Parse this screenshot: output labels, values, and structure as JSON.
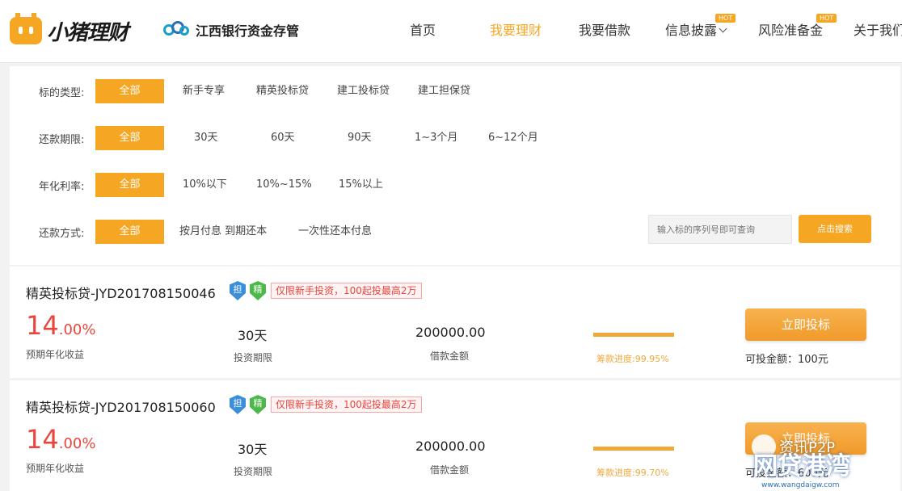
{
  "header": {
    "brand": "小猪理财",
    "bank": "江西银行资金存管",
    "nav": [
      {
        "label": "首页"
      },
      {
        "label": "我要理财"
      },
      {
        "label": "我要借款"
      },
      {
        "label": "信息披露",
        "badge": "HOT"
      },
      {
        "label": "风险准备金",
        "badge": "HOT"
      },
      {
        "label": "关于我们"
      }
    ]
  },
  "filters": {
    "type": {
      "label": "标的类型:",
      "options": [
        "全部",
        "新手专享",
        "精英投标贷",
        "建工投标贷",
        "建工担保贷"
      ]
    },
    "term": {
      "label": "还款期限:",
      "options": [
        "全部",
        "30天",
        "60天",
        "90天",
        "1~3个月",
        "6~12个月"
      ]
    },
    "rate": {
      "label": "年化利率:",
      "options": [
        "全部",
        "10%以下",
        "10%~15%",
        "15%以上"
      ]
    },
    "method": {
      "label": "还款方式:",
      "options": [
        "全部",
        "按月付息 到期还本",
        "一次性还本付息"
      ]
    },
    "search": {
      "placeholder": "输入标的序列号即可查询",
      "button": "点击搜索"
    }
  },
  "loans": [
    {
      "title": "精英投标贷-JYD201708150046",
      "badge1": "担",
      "badge2": "精",
      "tag": "仅限新手投资，100起投最高2万",
      "rate_int": "14",
      "rate_dec": ".00%",
      "rate_label": "预期年化收益",
      "term": "30天",
      "term_label": "投资期限",
      "amount": "200000.00",
      "amount_label": "借款金额",
      "progress": 99.95,
      "progress_text": "筹款进度:99.95%",
      "button": "立即投标",
      "available": "可投金额：100元"
    },
    {
      "title": "精英投标贷-JYD201708150060",
      "badge1": "担",
      "badge2": "精",
      "tag": "仅限新手投资，100起投最高2万",
      "rate_int": "14",
      "rate_dec": ".00%",
      "rate_label": "预期年化收益",
      "term": "30天",
      "term_label": "投资期限",
      "amount": "200000.00",
      "amount_label": "借款金额",
      "progress": 99.7,
      "progress_text": "筹款进度:99.70%",
      "button": "立即投标",
      "available": "可投金额：600元"
    }
  ],
  "watermark": {
    "line1": "资讯P2P",
    "line2": "网贷港湾",
    "url": "www.wangdaigw.com"
  },
  "colors": {
    "accent": "#f5a623",
    "rate_red": "#e8453c"
  }
}
